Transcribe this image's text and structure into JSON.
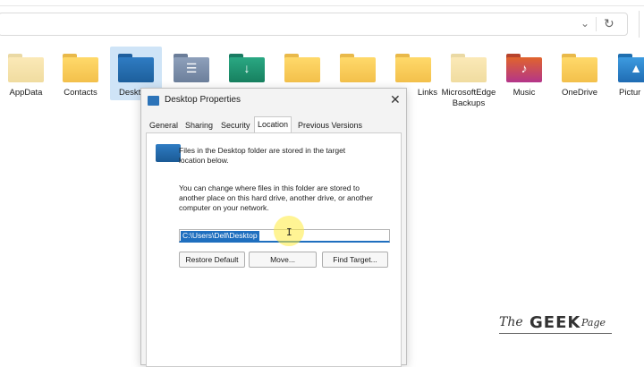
{
  "explorer": {
    "address_chevron": "⌄",
    "refresh_glyph": "↻",
    "folders": [
      {
        "label": "AppData",
        "icon": "folder-icon",
        "color": "pale"
      },
      {
        "label": "Contacts",
        "icon": "folder-icon",
        "color": "yellow"
      },
      {
        "label": "Deskt",
        "icon": "desktop-folder-icon",
        "color": "blue",
        "selected": true
      },
      {
        "label": "",
        "icon": "documents-folder-icon",
        "color": "gray"
      },
      {
        "label": "",
        "icon": "downloads-folder-icon",
        "color": "teal"
      },
      {
        "label": "",
        "icon": "folder-icon",
        "color": "yellow"
      },
      {
        "label": "",
        "icon": "folder-icon",
        "color": "yellow"
      },
      {
        "label": "Links",
        "icon": "folder-icon",
        "color": "yellow"
      },
      {
        "label": "MicrosoftEdgeBackups",
        "icon": "folder-icon",
        "color": "pale"
      },
      {
        "label": "Music",
        "icon": "music-folder-icon",
        "color": "music"
      },
      {
        "label": "OneDrive",
        "icon": "folder-icon",
        "color": "yellow"
      },
      {
        "label": "Pictur",
        "icon": "pictures-folder-icon",
        "color": "pics"
      }
    ]
  },
  "dialog": {
    "title": "Desktop Properties",
    "close_glyph": "✕",
    "tabs": [
      "General",
      "Sharing",
      "Security",
      "Location",
      "Previous Versions"
    ],
    "active_tab": "Location",
    "info_text": "Files in the Desktop folder are stored in the target location below.",
    "change_text": "You can change where files in this folder are stored to another place on this hard drive, another drive, or another computer on your network.",
    "path_value": "C:\\Users\\Dell\\Desktop",
    "buttons": {
      "restore": "Restore Default",
      "move": "Move...",
      "find": "Find Target..."
    }
  },
  "watermark": {
    "the": "The",
    "geek": "GEEK",
    "page": "Page"
  }
}
